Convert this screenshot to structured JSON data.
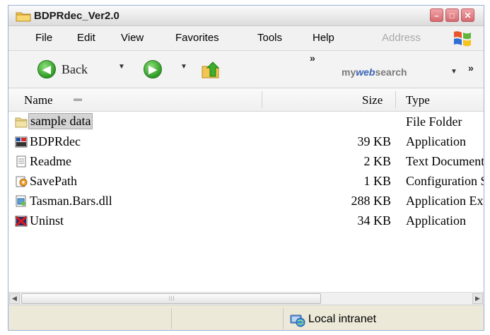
{
  "window": {
    "title": "BDPRdec_Ver2.0"
  },
  "menu": {
    "items": [
      "File",
      "Edit",
      "View",
      "Favorites",
      "Tools",
      "Help"
    ],
    "address_label": "Address"
  },
  "toolbar": {
    "back_label": "Back",
    "websearch_prefix": "my",
    "websearch_mid": "web",
    "websearch_suffix": "search",
    "chevron": "»"
  },
  "columns": {
    "name": "Name",
    "size": "Size",
    "type": "Type"
  },
  "files": [
    {
      "name": "sample data",
      "size": "",
      "type": "File Folder",
      "icon": "folder-icon",
      "selected": true
    },
    {
      "name": "BDPRdec",
      "size": "39 KB",
      "type": "Application",
      "icon": "app-icon",
      "selected": false
    },
    {
      "name": "Readme",
      "size": "2 KB",
      "type": "Text Document",
      "icon": "text-file-icon",
      "selected": false
    },
    {
      "name": "SavePath",
      "size": "1 KB",
      "type": "Configuration Settings",
      "icon": "config-file-icon",
      "selected": false
    },
    {
      "name": "Tasman.Bars.dll",
      "size": "288 KB",
      "type": "Application Extension",
      "icon": "dll-icon",
      "selected": false
    },
    {
      "name": "Uninst",
      "size": "34 KB",
      "type": "Application",
      "icon": "uninstall-icon",
      "selected": false
    }
  ],
  "status": {
    "zone": "Local intranet"
  },
  "colors": {
    "accent_green": "#2d9a25",
    "close_red": "#d66a6f",
    "window_bg": "#ece9d8"
  }
}
